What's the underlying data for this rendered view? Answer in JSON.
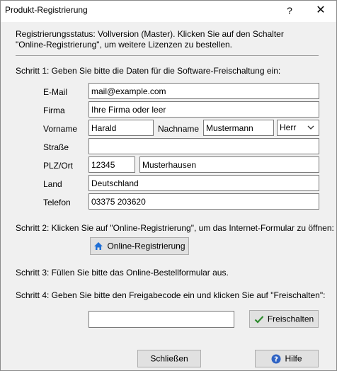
{
  "window": {
    "title": "Produkt-Registrierung",
    "help_glyph": "?",
    "close_glyph": "✕"
  },
  "status": {
    "line1": "Registrierungsstatus: Vollversion (Master). Klicken Sie auf den Schalter",
    "line2": "\"Online-Registrierung\", um weitere Lizenzen zu bestellen."
  },
  "step1": {
    "text": "Schritt 1: Geben Sie bitte die Daten für die Software-Freischaltung ein:",
    "fields": {
      "email": {
        "label": "E-Mail",
        "value": "mail@example.com"
      },
      "company": {
        "label": "Firma",
        "value": "Ihre Firma oder leer"
      },
      "firstname": {
        "label": "Vorname",
        "value": "Harald"
      },
      "lastname": {
        "label": "Nachname",
        "value": "Mustermann"
      },
      "salutation": {
        "value": "Herr"
      },
      "street": {
        "label": "Straße",
        "value": ""
      },
      "zip_city": {
        "label": "PLZ/Ort",
        "zip": "12345",
        "city": "Musterhausen"
      },
      "country": {
        "label": "Land",
        "value": "Deutschland"
      },
      "phone": {
        "label": "Telefon",
        "value": "03375 203620"
      }
    }
  },
  "step2": {
    "text": "Schritt 2: Klicken Sie auf \"Online-Registrierung\", um das Internet-Formular zu öffnen:",
    "button": "Online-Registrierung"
  },
  "step3": {
    "text": "Schritt 3: Füllen Sie bitte das Online-Bestellformular aus."
  },
  "step4": {
    "text": "Schritt 4: Geben Sie bitte den Freigabecode ein und klicken Sie auf \"Freischalten\":",
    "code_value": "",
    "button": "Freischalten"
  },
  "footer": {
    "close_button": "Schließen",
    "help_button": "Hilfe"
  },
  "colors": {
    "home_icon": "#1f6fd6",
    "check_icon": "#2e8b2e",
    "help_icon": "#2f63c4"
  }
}
